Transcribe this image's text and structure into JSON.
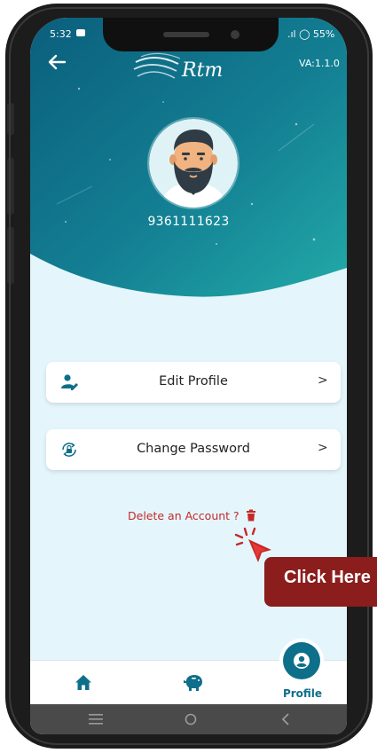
{
  "status_bar": {
    "time": "5:32",
    "right_text": ".ıl ◯ 55%"
  },
  "header": {
    "logo_text": "Rtm",
    "version": "VA:1.1.0"
  },
  "profile": {
    "phone_number": "9361111623"
  },
  "menu": {
    "edit_profile": {
      "label": "Edit Profile",
      "chevron": ">"
    },
    "change_password": {
      "label": "Change Password",
      "chevron": ">"
    }
  },
  "delete_account": {
    "label": "Delete an Account ?"
  },
  "callout": {
    "text": "Click Here"
  },
  "bottom_nav": {
    "profile_label": "Profile"
  },
  "colors": {
    "teal_dark": "#0e6f8a",
    "teal_light": "#1fa3a8",
    "delete_red": "#c62828",
    "callout_red": "#8b1d1d"
  }
}
